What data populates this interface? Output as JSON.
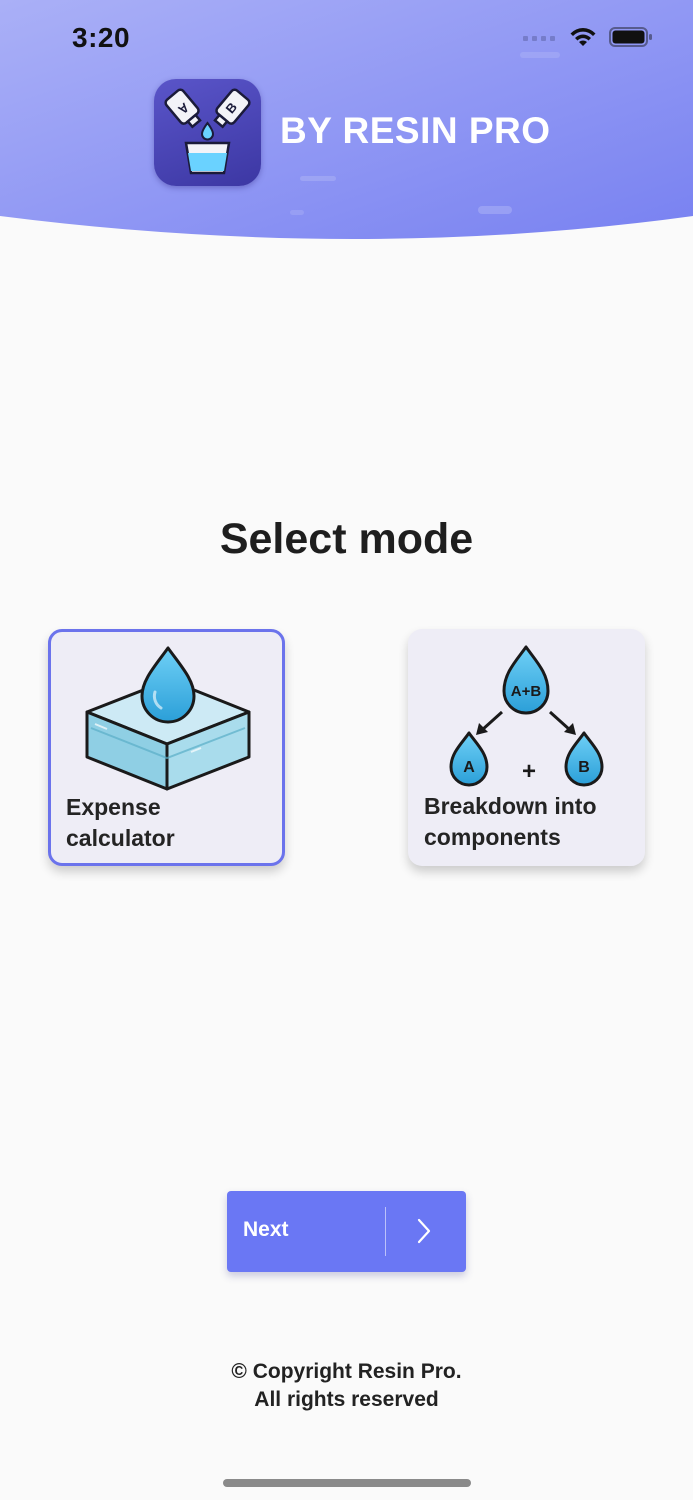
{
  "status_bar": {
    "time": "3:20"
  },
  "header": {
    "brand_title": "BY RESIN PRO",
    "logo_icon": "resin-mixing-bottles-icon",
    "bottle_a_letter": "A",
    "bottle_b_letter": "B"
  },
  "main": {
    "title": "Select mode",
    "modes": [
      {
        "label": "Expense\ncalculator",
        "icon": "resin-drop-box-icon",
        "selected": true
      },
      {
        "label": "Breakdown into\ncomponents",
        "icon": "resin-split-drops-icon",
        "selected": false,
        "drop_ab": "A+B",
        "drop_a": "A",
        "drop_b": "B",
        "plus": "+"
      }
    ]
  },
  "next_button": {
    "label": "Next",
    "icon": "chevron-right-icon"
  },
  "footer": {
    "copyright": "© Copyright Resin Pro.",
    "rights": "All rights reserved"
  },
  "colors": {
    "header_gradient_start": "#a7adf6",
    "header_gradient_end": "#7b84f2",
    "accent": "#6a77f4",
    "selected_border": "#6b73ec",
    "card_background": "#eeedf6"
  }
}
